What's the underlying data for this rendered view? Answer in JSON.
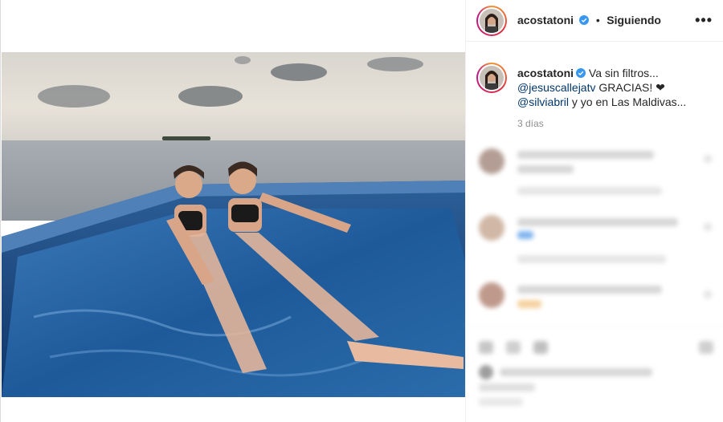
{
  "header": {
    "username": "acostatoni",
    "separator": "•",
    "follow_state": "Siguiendo",
    "more_label": "•••"
  },
  "caption": {
    "username": "acostatoni",
    "text_1": "Va sin filtros...",
    "mention_1": "@jesuscallejatv",
    "text_2": "GRACIAS! ❤",
    "mention_2": "@silviabril",
    "text_3": "y yo en Las Maldivas...",
    "time": "3 días"
  },
  "colors": {
    "verified": "#3897f0",
    "mention": "#00376b",
    "muted": "#8e8e8e"
  },
  "icons": [
    "verified-badge-icon",
    "more-options-icon"
  ]
}
